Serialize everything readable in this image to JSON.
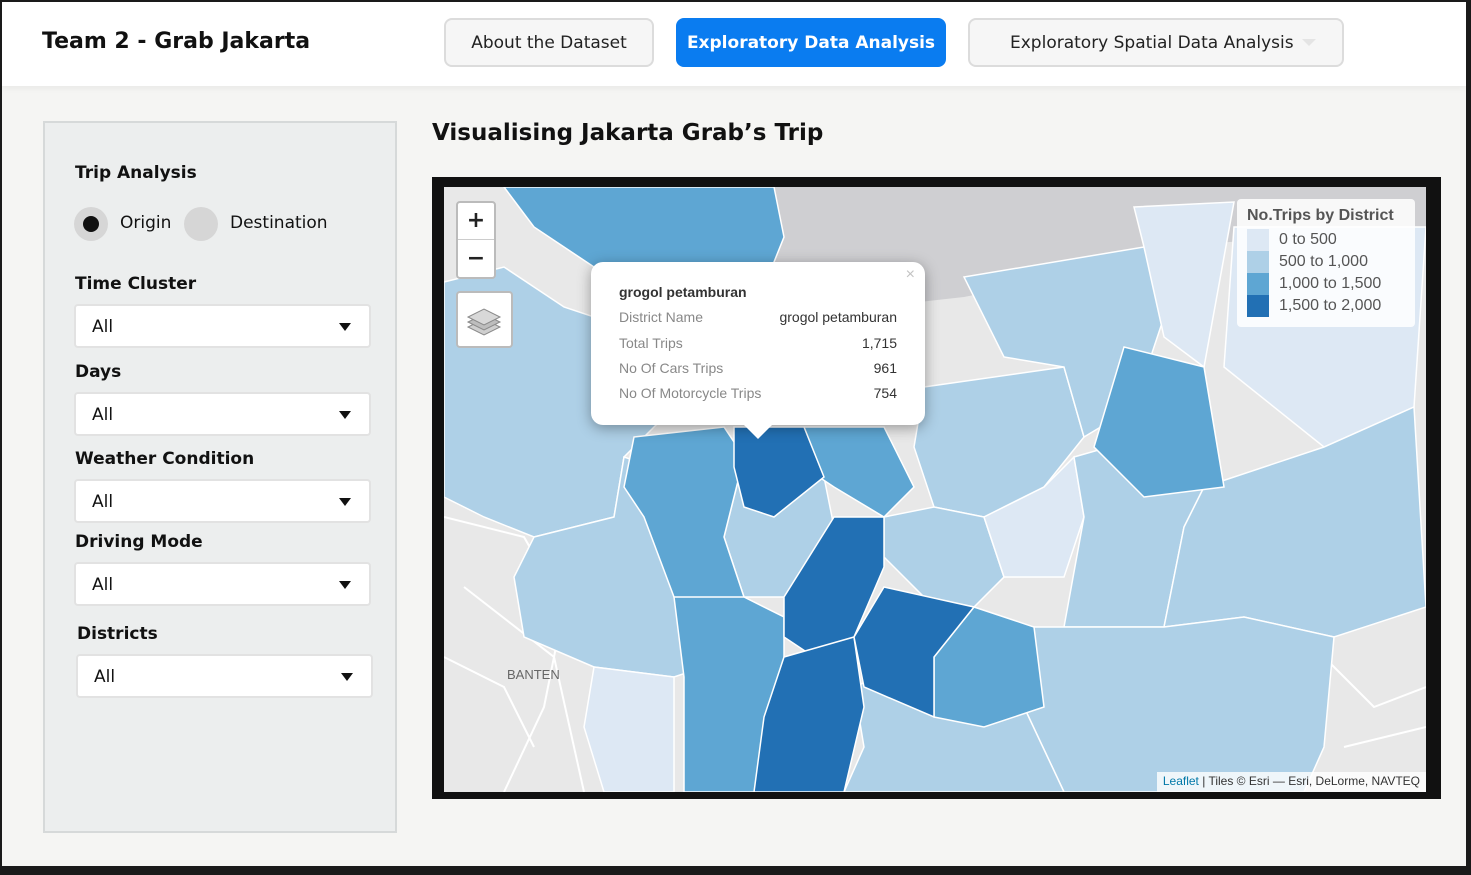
{
  "header": {
    "title": "Team 2 - Grab Jakarta",
    "tabs": [
      {
        "label": "About the Dataset"
      },
      {
        "label": "Exploratory Data Analysis"
      },
      {
        "label": "Exploratory Spatial Data Analysis"
      }
    ],
    "active_tab": "Exploratory Data Analysis",
    "accent_color": "#0a7cf0"
  },
  "sidebar": {
    "trip_analysis": {
      "label": "Trip Analysis",
      "options": [
        "Origin",
        "Destination"
      ],
      "selected": "Origin"
    },
    "filters": [
      {
        "label": "Time Cluster",
        "value": "All"
      },
      {
        "label": "Days",
        "value": "All"
      },
      {
        "label": "Weather Condition",
        "value": "All"
      },
      {
        "label": "Driving Mode",
        "value": "All"
      },
      {
        "label": "Districts",
        "value": "All"
      }
    ]
  },
  "main": {
    "title": "Visualising Jakarta Grab’s Trip"
  },
  "map": {
    "zoom_in": "+",
    "zoom_out": "−",
    "layers_icon": "layers-icon",
    "place_label": "BANTEN",
    "legend": {
      "title": "No.Trips by District",
      "entries": [
        {
          "label": "0 to 500",
          "color": "#dde8f4"
        },
        {
          "label": "500 to 1,000",
          "color": "#aed0e7"
        },
        {
          "label": "1,000 to 1,500",
          "color": "#5ea6d3"
        },
        {
          "label": "1,500 to 2,000",
          "color": "#2270b4"
        }
      ]
    },
    "popup": {
      "close": "×",
      "title": "grogol petamburan",
      "rows": [
        {
          "key": "District Name",
          "value": "grogol petamburan"
        },
        {
          "key": "Total Trips",
          "value": "1,715"
        },
        {
          "key": "No Of Cars Trips",
          "value": "961"
        },
        {
          "key": "No Of Motorcycle Trips",
          "value": "754"
        }
      ]
    },
    "attribution": {
      "link": "Leaflet",
      "text": " | Tiles © Esri — Esri, DeLorme, NAVTEQ"
    }
  }
}
